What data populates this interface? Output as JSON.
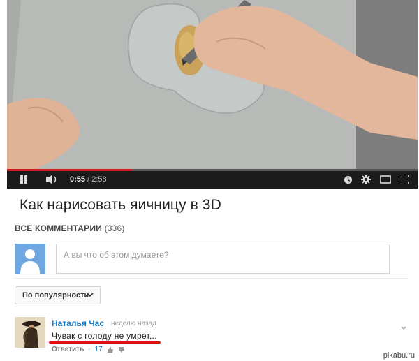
{
  "video": {
    "current_time": "0:55",
    "separator": " / ",
    "duration": "2:58",
    "progress": 0.305,
    "accent_color": "#cc181e",
    "controls": [
      "pause-icon",
      "volume-icon",
      "autoplay-icon",
      "settings-icon",
      "theater-mode-icon",
      "fullscreen-icon"
    ]
  },
  "title": "Как нарисовать яичницу в 3D",
  "comments": {
    "heading": "ВСЕ КОММЕНТАРИИ",
    "count": "(336)",
    "input_placeholder": "А вы что об этом думаете?",
    "sort_label": "По популярности",
    "items": [
      {
        "author": "Наталья Час",
        "time": "неделю назад",
        "text": "Чувак с голоду не умрет...",
        "reply_label": "Ответить",
        "dot": "·",
        "likes": "17",
        "underline_color": "#e01010"
      }
    ]
  },
  "watermark": "pikabu.ru"
}
